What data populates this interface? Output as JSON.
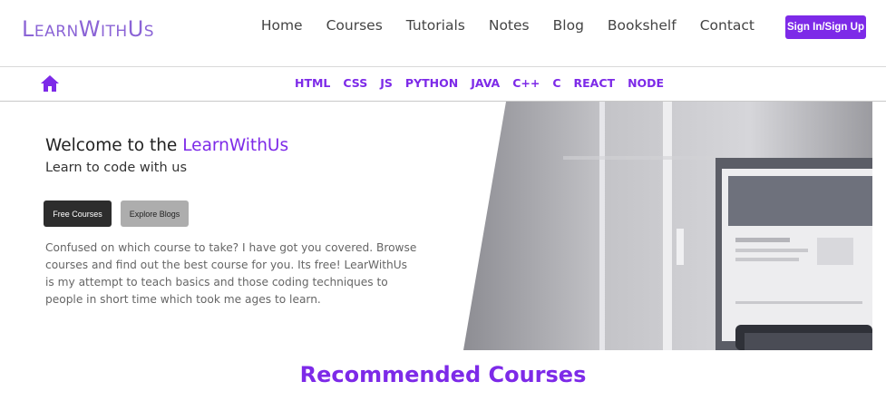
{
  "brand": {
    "name_part1_big": "L",
    "name_part1_small": "EARN",
    "name_part2_big": "W",
    "name_part2_small": "ITH",
    "name_part3_big": "U",
    "name_part3_small": "S"
  },
  "nav": {
    "links": [
      "Home",
      "Courses",
      "Tutorials",
      "Notes",
      "Blog",
      "Bookshelf",
      "Contact"
    ],
    "signin_label": "Sign In/Sign Up"
  },
  "subnav": {
    "home_icon": "home-icon",
    "links": [
      "HTML",
      "CSS",
      "JS",
      "PYTHON",
      "JAVA",
      "C++",
      "C",
      "REACT",
      "NODE"
    ]
  },
  "hero": {
    "title_prefix": "Welcome to the ",
    "title_accent": "LearnWithUs",
    "subtitle": "Learn to code with us",
    "btn_free": "Free Courses",
    "btn_blogs": "Explore Blogs",
    "paragraph": "Confused on which course to take? I have got you covered. Browse courses and find out the best course for you. Its free! LearWithUs is my attempt to teach basics and those coding techniques to people in short time which took me ages to learn."
  },
  "recommended": {
    "title": "Recommended Courses"
  },
  "colors": {
    "accent": "#7d2ae8",
    "brand": "#8b64d6",
    "dark_button": "#2d2d2d",
    "grey_button": "#adadad"
  }
}
